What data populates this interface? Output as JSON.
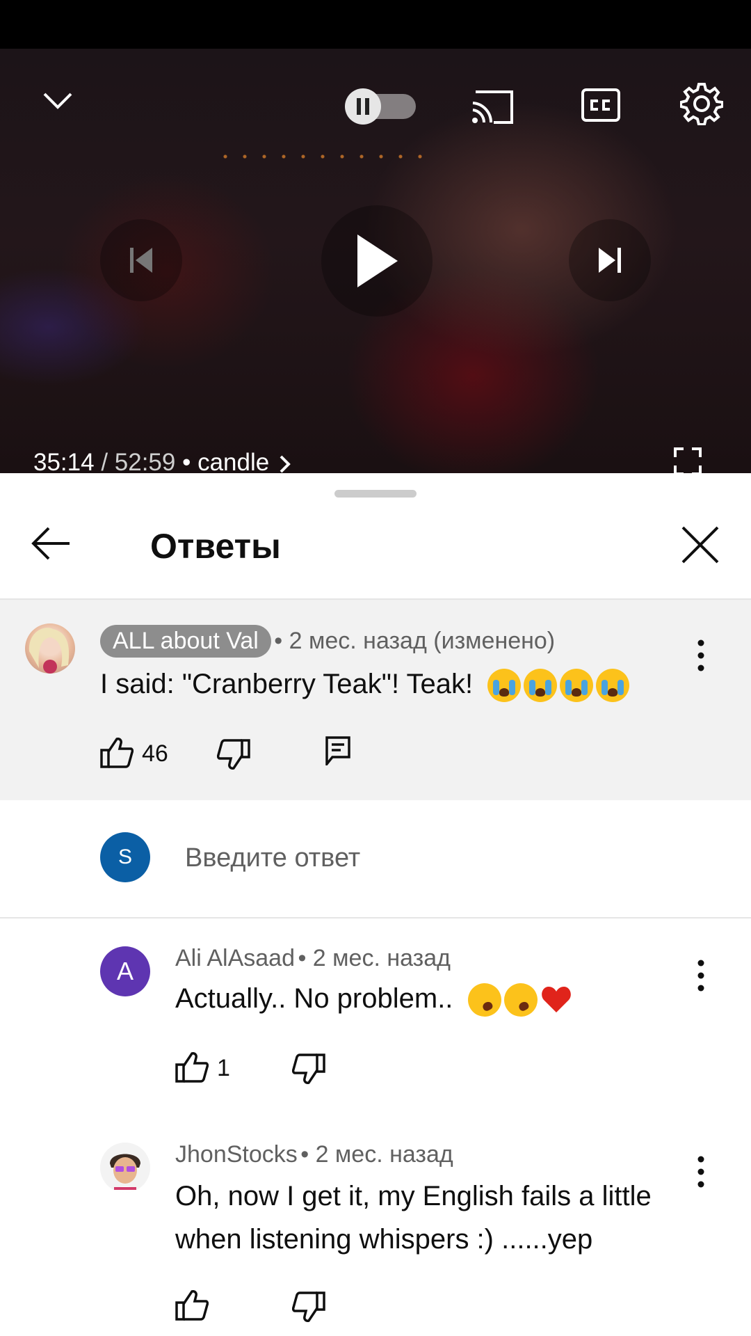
{
  "player": {
    "time_current": "35:14",
    "time_separator": " / ",
    "time_total": "52:59",
    "chapter_separator": " • ",
    "chapter": "candle",
    "progress_fraction": 0.664,
    "autoplay": "paused"
  },
  "sheet": {
    "title": "Ответы"
  },
  "parent_comment": {
    "author": "ALL about Val",
    "meta": "• 2 мес. назад (изменено)",
    "text": "I said: \"Cranberry Teak\"! Teak!",
    "emojis": [
      "loudly-crying-face",
      "loudly-crying-face",
      "loudly-crying-face",
      "loudly-crying-face"
    ],
    "likes": "46"
  },
  "reply_input": {
    "avatar_letter": "S",
    "placeholder": "Введите ответ"
  },
  "replies": [
    {
      "author": "Ali AlAsaad",
      "avatar_letter": "A",
      "meta": "• 2 мес. назад",
      "text": "Actually.. No problem..",
      "emojis": [
        "rolling-laughing-face",
        "rolling-laughing-face",
        "red-heart"
      ],
      "likes": "1"
    },
    {
      "author": "JhonStocks",
      "meta": "• 2 мес. назад",
      "text_line1": "Oh, now I get it, my English fails a little",
      "text_line2": "when listening whispers :) ......yep",
      "likes": ""
    }
  ],
  "colors": {
    "accent_red": "#ff0000",
    "avatar_s": "#0b5fa5",
    "avatar_a": "#5e35b1",
    "chip_bg": "#8d8d8d",
    "highlight_bg": "#f2f2f2"
  }
}
